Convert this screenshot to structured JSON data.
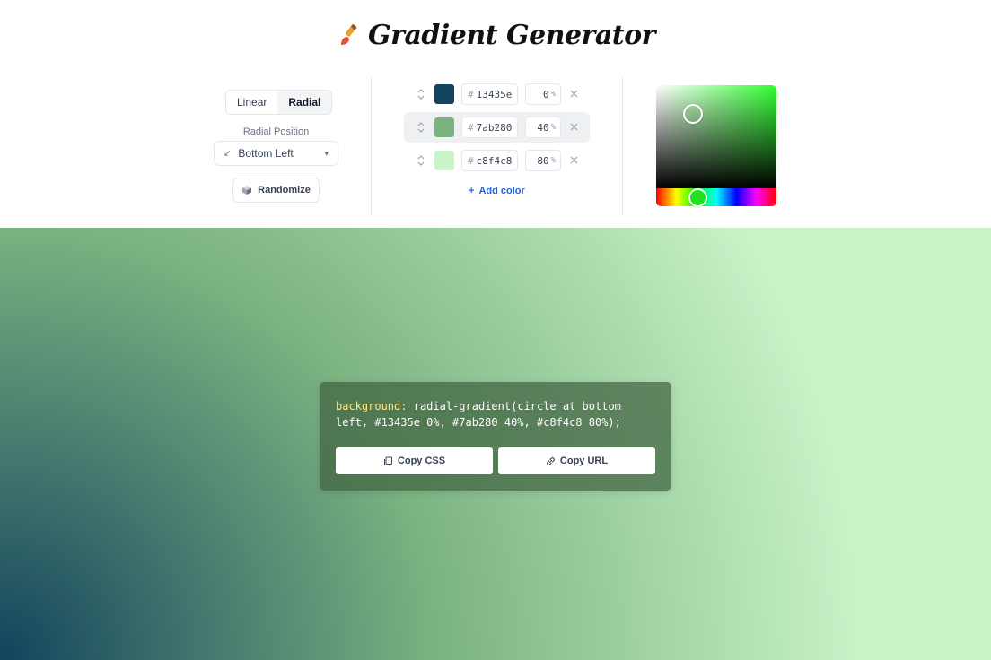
{
  "header": {
    "title": "Gradient Generator",
    "icon": "paintbrush-icon"
  },
  "gradient_type": {
    "options": [
      "Linear",
      "Radial"
    ],
    "selected": "Radial"
  },
  "radial_position": {
    "label": "Radial Position",
    "value": "Bottom Left"
  },
  "randomize": {
    "label": "Randomize"
  },
  "stops": [
    {
      "hash": "#",
      "hex": "13435e",
      "color": "#13435e",
      "percent": "0",
      "unit": "%"
    },
    {
      "hash": "#",
      "hex": "7ab280",
      "color": "#7ab280",
      "percent": "40",
      "unit": "%"
    },
    {
      "hash": "#",
      "hex": "c8f4c8",
      "color": "#c8f4c8",
      "percent": "80",
      "unit": "%"
    }
  ],
  "add_color": {
    "plus": "+",
    "label": "Add color"
  },
  "css_output": {
    "property": "background:",
    "value": "radial-gradient(circle at bottom left, #13435e 0%, #7ab280 40%, #c8f4c8 80%);"
  },
  "buttons": {
    "copy_css": "Copy CSS",
    "copy_url": "Copy URL"
  },
  "colors": {
    "accent": "#2563eb",
    "card": "#406340"
  }
}
